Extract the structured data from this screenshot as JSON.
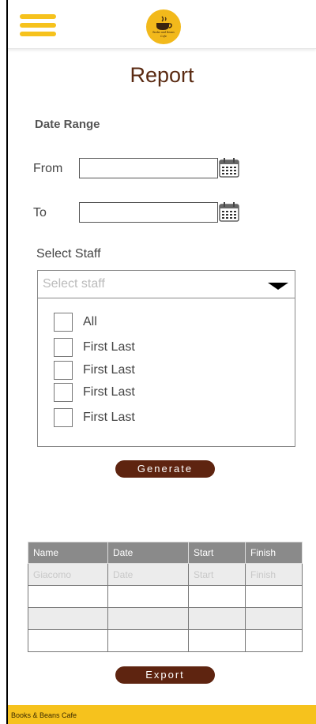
{
  "header": {
    "menu_icon": "hamburger-menu-icon",
    "logo_icon": "coffee-cup-logo",
    "logo_text_line1": "Books and Beans",
    "logo_text_line2": "Cafe"
  },
  "page": {
    "title": "Report",
    "date_range_label": "Date Range",
    "from_label": "From",
    "to_label": "To",
    "from_value": "",
    "to_value": "",
    "calendar_icon": "calendar-icon"
  },
  "staff": {
    "label": "Select Staff",
    "placeholder": "Select staff",
    "options": [
      {
        "label": "All",
        "checked": false
      },
      {
        "label": "First Last",
        "checked": false
      },
      {
        "label": "First Last",
        "checked": false
      },
      {
        "label": "First Last",
        "checked": false
      },
      {
        "label": "First Last",
        "checked": false
      }
    ]
  },
  "actions": {
    "generate_label": "Generate",
    "export_label": "Export"
  },
  "table": {
    "columns": [
      "Name",
      "Date",
      "Start",
      "Finish"
    ],
    "rows": [
      [
        "Giacomo",
        "Date",
        "Start",
        "Finish"
      ],
      [
        "",
        "",
        "",
        ""
      ],
      [
        "",
        "",
        "",
        ""
      ],
      [
        "",
        "",
        "",
        ""
      ]
    ]
  },
  "footer": {
    "text": "Books & Beans Cafe"
  },
  "colors": {
    "accent_yellow": "#f6c21d",
    "brand_brown": "#5e2410",
    "title_brown": "#5a2a12",
    "table_header_gray": "#8a8a8a"
  }
}
